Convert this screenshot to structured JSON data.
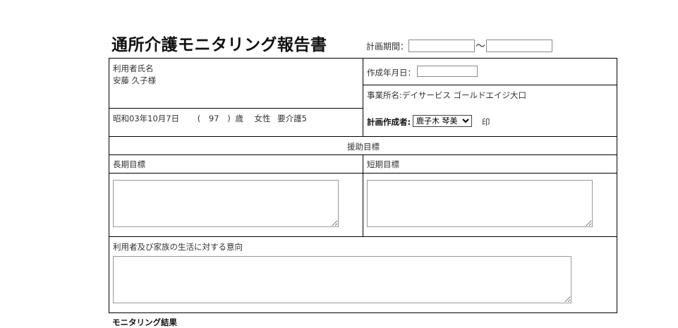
{
  "header": {
    "title": "通所介護モニタリング報告書",
    "period_label": "計画期間：",
    "period_separator": "〜",
    "period_start_value": "",
    "period_end_value": ""
  },
  "user": {
    "name_label": "利用者氏名",
    "name_value": "安藤 久子様",
    "birth_date": "昭和03年10月7日",
    "age_open": "(",
    "age": "97",
    "age_close": ")",
    "age_unit": "歳",
    "gender": "女性",
    "care_level": "要介護5"
  },
  "doc": {
    "created_label": "作成年月日：",
    "created_value": "",
    "office_label": "事業所名:",
    "office_value": "デイサービス ゴールドエイジ大口",
    "planner_label": "計画作成者:",
    "planner_selected": "鹿子木 琴美",
    "seal": "印"
  },
  "sections": {
    "support_goal": "援助目標",
    "long_term": "長期目標",
    "short_term": "短期目標",
    "intention": "利用者及び家族の生活に対する意向",
    "monitoring": "モニタリング結果"
  }
}
